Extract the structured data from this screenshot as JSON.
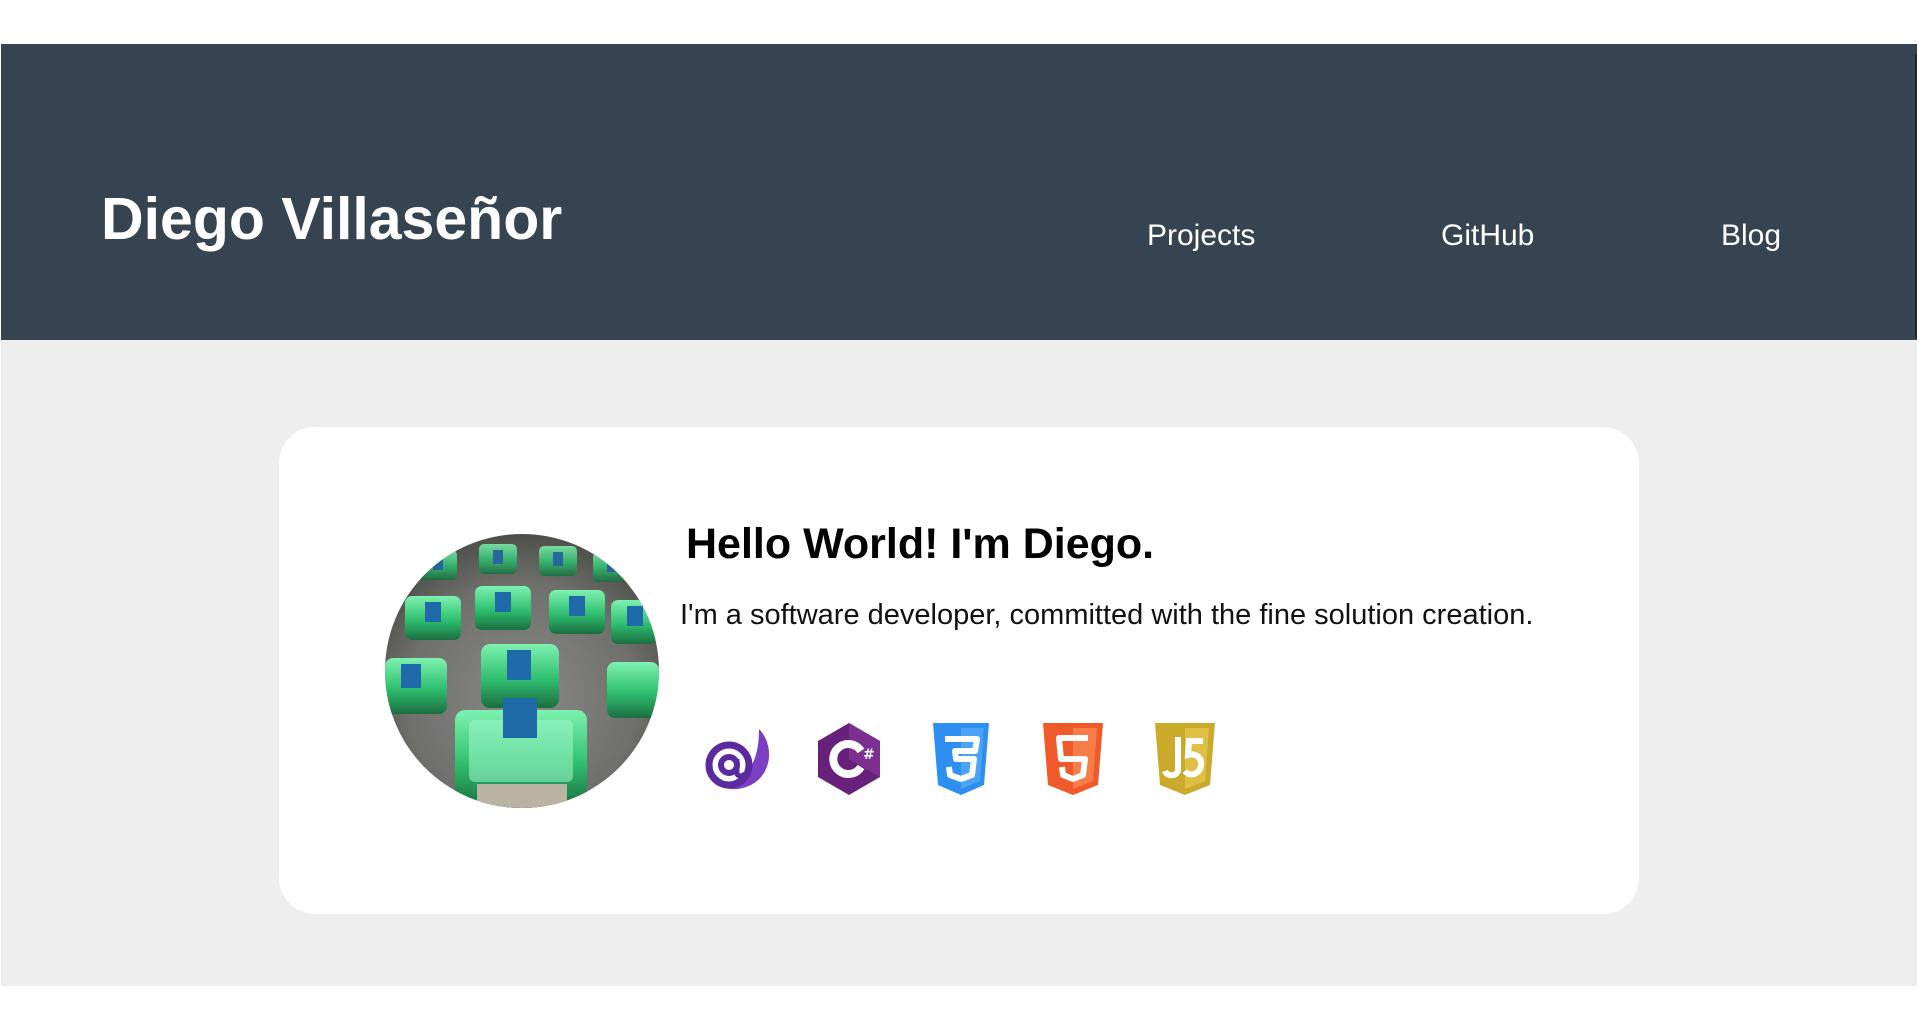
{
  "header": {
    "title": "Diego Villaseñor",
    "nav": [
      {
        "label": "Projects"
      },
      {
        "label": "GitHub"
      },
      {
        "label": "Blog"
      }
    ],
    "background": "#364452"
  },
  "intro_card": {
    "heading": "Hello World! I'm Diego.",
    "description": "I'm a software developer, committed with the fine solution creation.",
    "avatar_icon": "mechanical-keyboard-switches-photo",
    "tech_icons": [
      {
        "icon": "blazor-icon",
        "color": "#6b2bb0"
      },
      {
        "icon": "csharp-icon",
        "color": "#68217a"
      },
      {
        "icon": "css3-icon",
        "color": "#2d8ff0"
      },
      {
        "icon": "html5-icon",
        "color": "#f0592a"
      },
      {
        "icon": "javascript-icon",
        "color": "#d4b830"
      }
    ]
  },
  "colors": {
    "page_background": "#eeeeee",
    "card_background": "#ffffff"
  }
}
